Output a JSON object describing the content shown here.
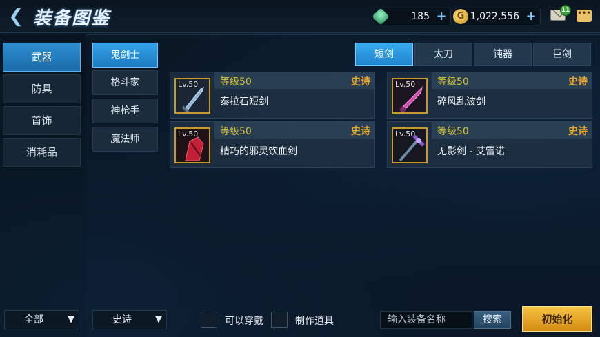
{
  "header": {
    "title": "装备图鉴",
    "back_icon": "chevron-left-icon",
    "gem_amount": "185",
    "gold_amount": "1,022,556",
    "mail_count": "11"
  },
  "categories": [
    {
      "label": "武器",
      "active": true
    },
    {
      "label": "防具",
      "active": false
    },
    {
      "label": "首饰",
      "active": false
    },
    {
      "label": "消耗品",
      "active": false
    }
  ],
  "classes": [
    {
      "label": "鬼剑士",
      "active": true
    },
    {
      "label": "格斗家",
      "active": false
    },
    {
      "label": "神枪手",
      "active": false
    },
    {
      "label": "魔法师",
      "active": false
    }
  ],
  "weapon_tabs": [
    {
      "label": "短剑",
      "active": true
    },
    {
      "label": "太刀",
      "active": false
    },
    {
      "label": "钝器",
      "active": false
    },
    {
      "label": "巨剑",
      "active": false
    }
  ],
  "items": [
    {
      "level_badge": "Lv.50",
      "level_text": "等级50",
      "rarity": "史诗",
      "name": "泰拉石短剑",
      "icon": "dagger-icon"
    },
    {
      "level_badge": "Lv.50",
      "level_text": "等级50",
      "rarity": "史诗",
      "name": "碎风乱波剑",
      "icon": "pink-dagger-icon"
    },
    {
      "level_badge": "Lv.50",
      "level_text": "等级50",
      "rarity": "史诗",
      "name": "精巧的邪灵饮血剑",
      "icon": "blood-sword-icon"
    },
    {
      "level_badge": "Lv.50",
      "level_text": "等级50",
      "rarity": "史诗",
      "name": "无影剑 - 艾雷诺",
      "icon": "shadow-sword-icon"
    }
  ],
  "footer": {
    "filter_all": "全部",
    "filter_rarity": "史诗",
    "wearable_label": "可以穿戴",
    "craft_label": "制作道具",
    "search_placeholder": "输入装备名称",
    "search_label": "搜索",
    "reset_label": "初始化"
  },
  "colors": {
    "active_tab": "#2e8fd0",
    "rarity_epic": "#e7a72c",
    "level_text": "#d8c23a",
    "reset_button": "#e8a82a"
  }
}
